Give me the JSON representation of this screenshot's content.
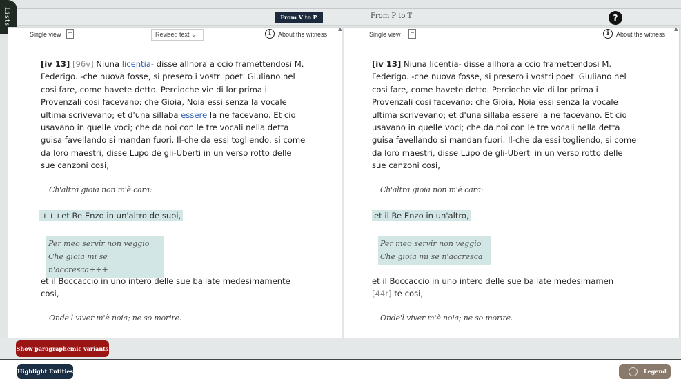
{
  "lists_tab": "Lists",
  "top": {
    "from_v_to_p": "From V to P",
    "from_p_to_t": "From P to T",
    "help": "?"
  },
  "left": {
    "single_view": "Single view",
    "revised_text": "Revised text",
    "about": "About the witness",
    "para1": {
      "ref": "[iv 13]",
      "folio": "[96v]",
      "w1": "Niuna",
      "link1": "licentia",
      "t1": "- disse allhora a ccio framettendosi M. Federigo. -che nuova fosse, si presero i vostri poeti Giuliano nel cosi fare, come havete detto. Percioche vie di lor prima i Provenzali cosi facevano: che Gioia, Noia essi senza la vocale ultima scrivevano; et d'una sillaba",
      "link2": "essere",
      "t2": "la ne facevano. Et cio usavano in quelle voci; che da noi con le tre vocali nella detta guisa favellando si mandan fuori. Il-che da essi togliendo, si come da loro maestri, disse Lupo de gli-Uberti in un verso rotto delle sue canzoni cosi,"
    },
    "verse1": "Ch'altra gioia non m'è cara:",
    "hl_line": "+++et Re Enzo in un'altro ",
    "hl_strike": "de suoi,",
    "hl_verse1": "Per meo servir non veggio",
    "hl_verse2": "Che gioia mi se n'accresca+++",
    "para2": "et il Boccaccio in uno intero delle sue ballate medesimamente cosi,",
    "verse2": "Onde'l viver m'è noia; ne so morire."
  },
  "right": {
    "single_view": "Single view",
    "about": "About the witness",
    "para1": {
      "ref": "[iv 13]",
      "t1": "Niuna licentia- disse allhora a ccio framettendosi M. Federigo. -che nuova fosse, si presero i vostri poeti Giuliano nel cosi fare, come havete detto. Percioche vie di lor prima i Provenzali cosi facevano: che Gioia, Noia essi senza la vocale ultima scrivevano; et d'una sillaba essere la ne facevano. Et cio usavano in quelle voci; che da noi con le tre vocali nella detta guisa favellando si mandan fuori. Il-che da essi togliendo, si come da loro maestri, disse Lupo de gli-Uberti in un verso rotto delle sue canzoni cosi,"
    },
    "verse1": "Ch'altra gioia non m'è cara:",
    "hl_line": "et il Re Enzo in un'altro,",
    "hl_verse1": "Per meo servir non veggio",
    "hl_verse2": "Che gioia mi se n'accresca",
    "para2_a": "et il Boccaccio in uno intero delle sue ballate medesimamen",
    "para2_folio": "[44r]",
    "para2_b": "te cosi,",
    "verse2": "Onde'l viver m'è noia; ne so morire."
  },
  "bottom": {
    "show_variants": "Show paragraphemic variants",
    "highlight": "Highlight Entities",
    "legend": "Legend"
  }
}
